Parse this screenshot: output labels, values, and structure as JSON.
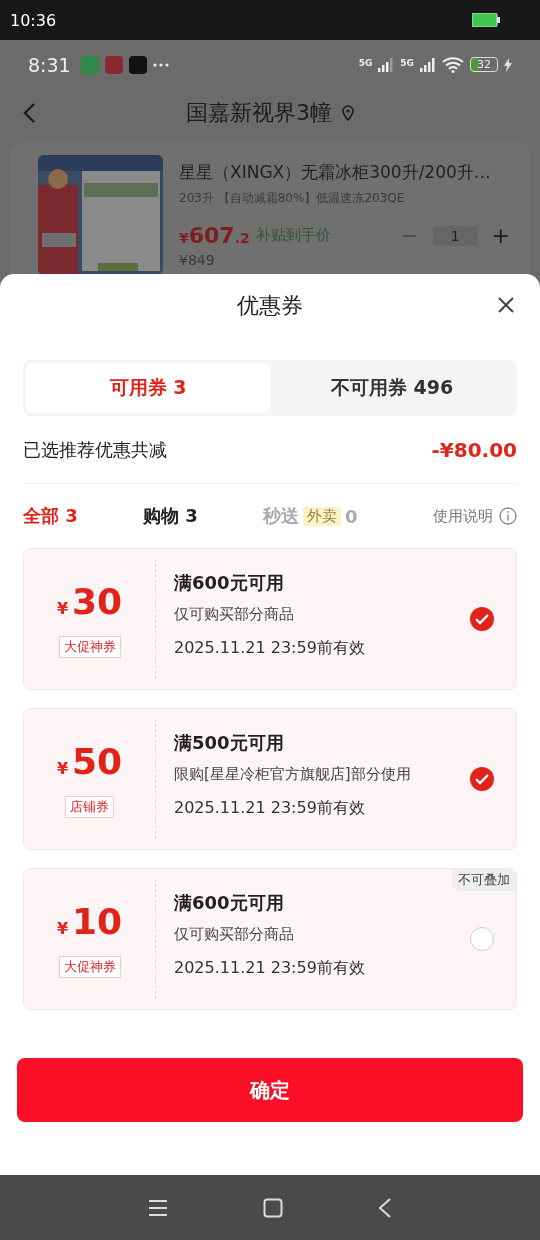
{
  "outer_status_bar": {
    "time": "10:36"
  },
  "status_bar": {
    "time": "8:31",
    "network_1": "5G",
    "network_2": "5G",
    "battery": "32"
  },
  "header": {
    "title": "国嘉新视界3幢"
  },
  "product": {
    "kind": "picture",
    "name": "星星（XINGX）无霜冰柜300升/200升…",
    "spec": "203升 【自动减霜80%】低温速冻203QE",
    "currency": "¥",
    "price_integer": "607",
    "price_decimal": ".2",
    "price_note": "补贴到手价",
    "quantity": "1",
    "minus": "−",
    "plus": "+",
    "original_price": "¥849"
  },
  "sheet": {
    "title": "优惠券",
    "tabs": [
      {
        "label": "可用券 3",
        "selected": true
      },
      {
        "label": "不可用券 496",
        "selected": false
      }
    ],
    "summary": {
      "label": "已选推荐优惠共减",
      "amount": "-¥80.00"
    },
    "filters": [
      {
        "label": "全部 3",
        "selected": true,
        "disabled": false
      },
      {
        "label": "购物 3",
        "selected": false,
        "disabled": false
      },
      {
        "label": "秒送",
        "badge": "外卖",
        "count": "0",
        "selected": false,
        "disabled": true
      }
    ],
    "help": "使用说明",
    "coupons": [
      {
        "currency": "¥",
        "amount": "30",
        "tag": "大促神券",
        "title": "满600元可用",
        "description": "仅可购买部分商品",
        "validity": "2025.11.21 23:59前有效",
        "checked": true
      },
      {
        "currency": "¥",
        "amount": "50",
        "tag": "店铺券",
        "title": "满500元可用",
        "description": "限购[星星冷柜官方旗舰店]部分使用",
        "validity": "2025.11.21 23:59前有效",
        "checked": true
      },
      {
        "currency": "¥",
        "amount": "10",
        "tag": "大促神券",
        "title": "满600元可用",
        "description": "仅可购买部分商品",
        "validity": "2025.11.21 23:59前有效",
        "checked": false,
        "badge": "不可叠加"
      }
    ],
    "confirm": "确定"
  }
}
